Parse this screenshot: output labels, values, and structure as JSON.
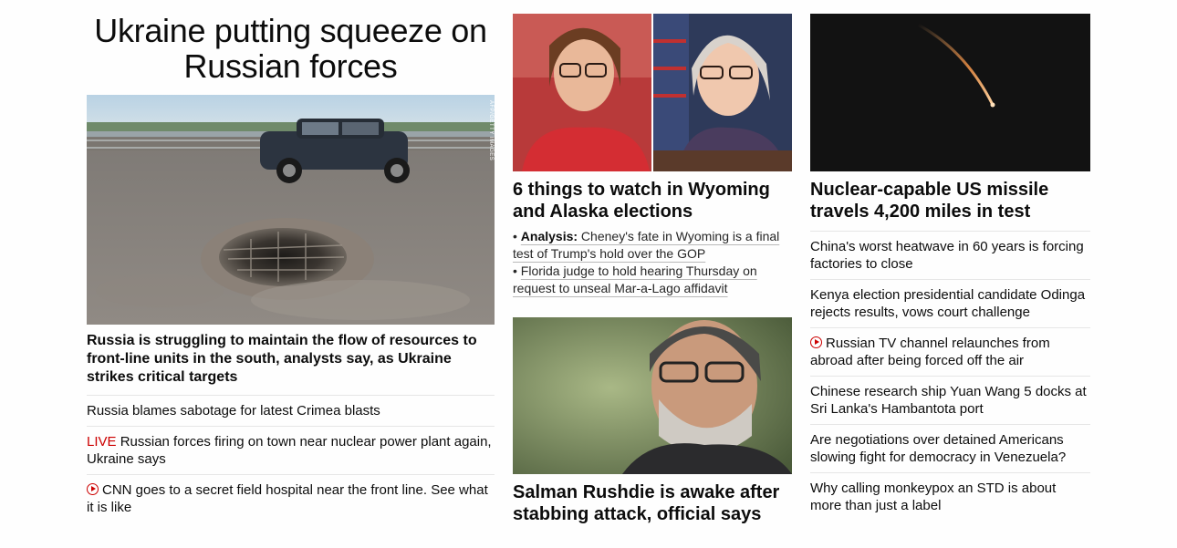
{
  "lead": {
    "headline": "Ukraine putting squeeze on Russian forces",
    "image_credit": "AFP/GETTY IMAGES",
    "summary": "Russia is struggling to maintain the flow of resources to front-line units in the south, analysts say, as Ukraine strikes critical targets",
    "links": [
      {
        "prefix": "",
        "text": "Russia blames sabotage for latest Crimea blasts"
      },
      {
        "prefix": "LIVE",
        "text": " Russian forces firing on town near nuclear power plant again, Ukraine says"
      },
      {
        "prefix": "video",
        "text": "CNN goes to a secret field hospital near the front line. See what it is like"
      }
    ]
  },
  "middle": {
    "story1": {
      "headline": "6 things to watch in Wyoming and Alaska elections",
      "sub1_label": "Analysis:",
      "sub1_text": " Cheney's fate in Wyoming is a final test of Trump's hold over the GOP",
      "sub2_text": "Florida judge to hold hearing Thursday on request to unseal Mar-a-Lago affidavit"
    },
    "story2": {
      "headline": "Salman Rushdie is awake after stabbing attack, official says"
    }
  },
  "right": {
    "headline": "Nuclear-capable US missile travels 4,200 miles in test",
    "links": [
      {
        "video": false,
        "text": "China's worst heatwave in 60 years is forcing factories to close"
      },
      {
        "video": false,
        "text": "Kenya election presidential candidate Odinga rejects results, vows court challenge"
      },
      {
        "video": true,
        "text": "Russian TV channel relaunches from abroad after being forced off the air"
      },
      {
        "video": false,
        "text": "Chinese research ship Yuan Wang 5 docks at Sri Lanka's Hambantota port"
      },
      {
        "video": false,
        "text": "Are negotiations over detained Americans slowing fight for democracy in Venezuela?"
      },
      {
        "video": false,
        "text": "Why calling monkeypox an STD is about more than just a label"
      }
    ]
  },
  "colors": {
    "live": "#cc0000",
    "text": "#0c0c0c",
    "divider": "#e6e6e6"
  }
}
